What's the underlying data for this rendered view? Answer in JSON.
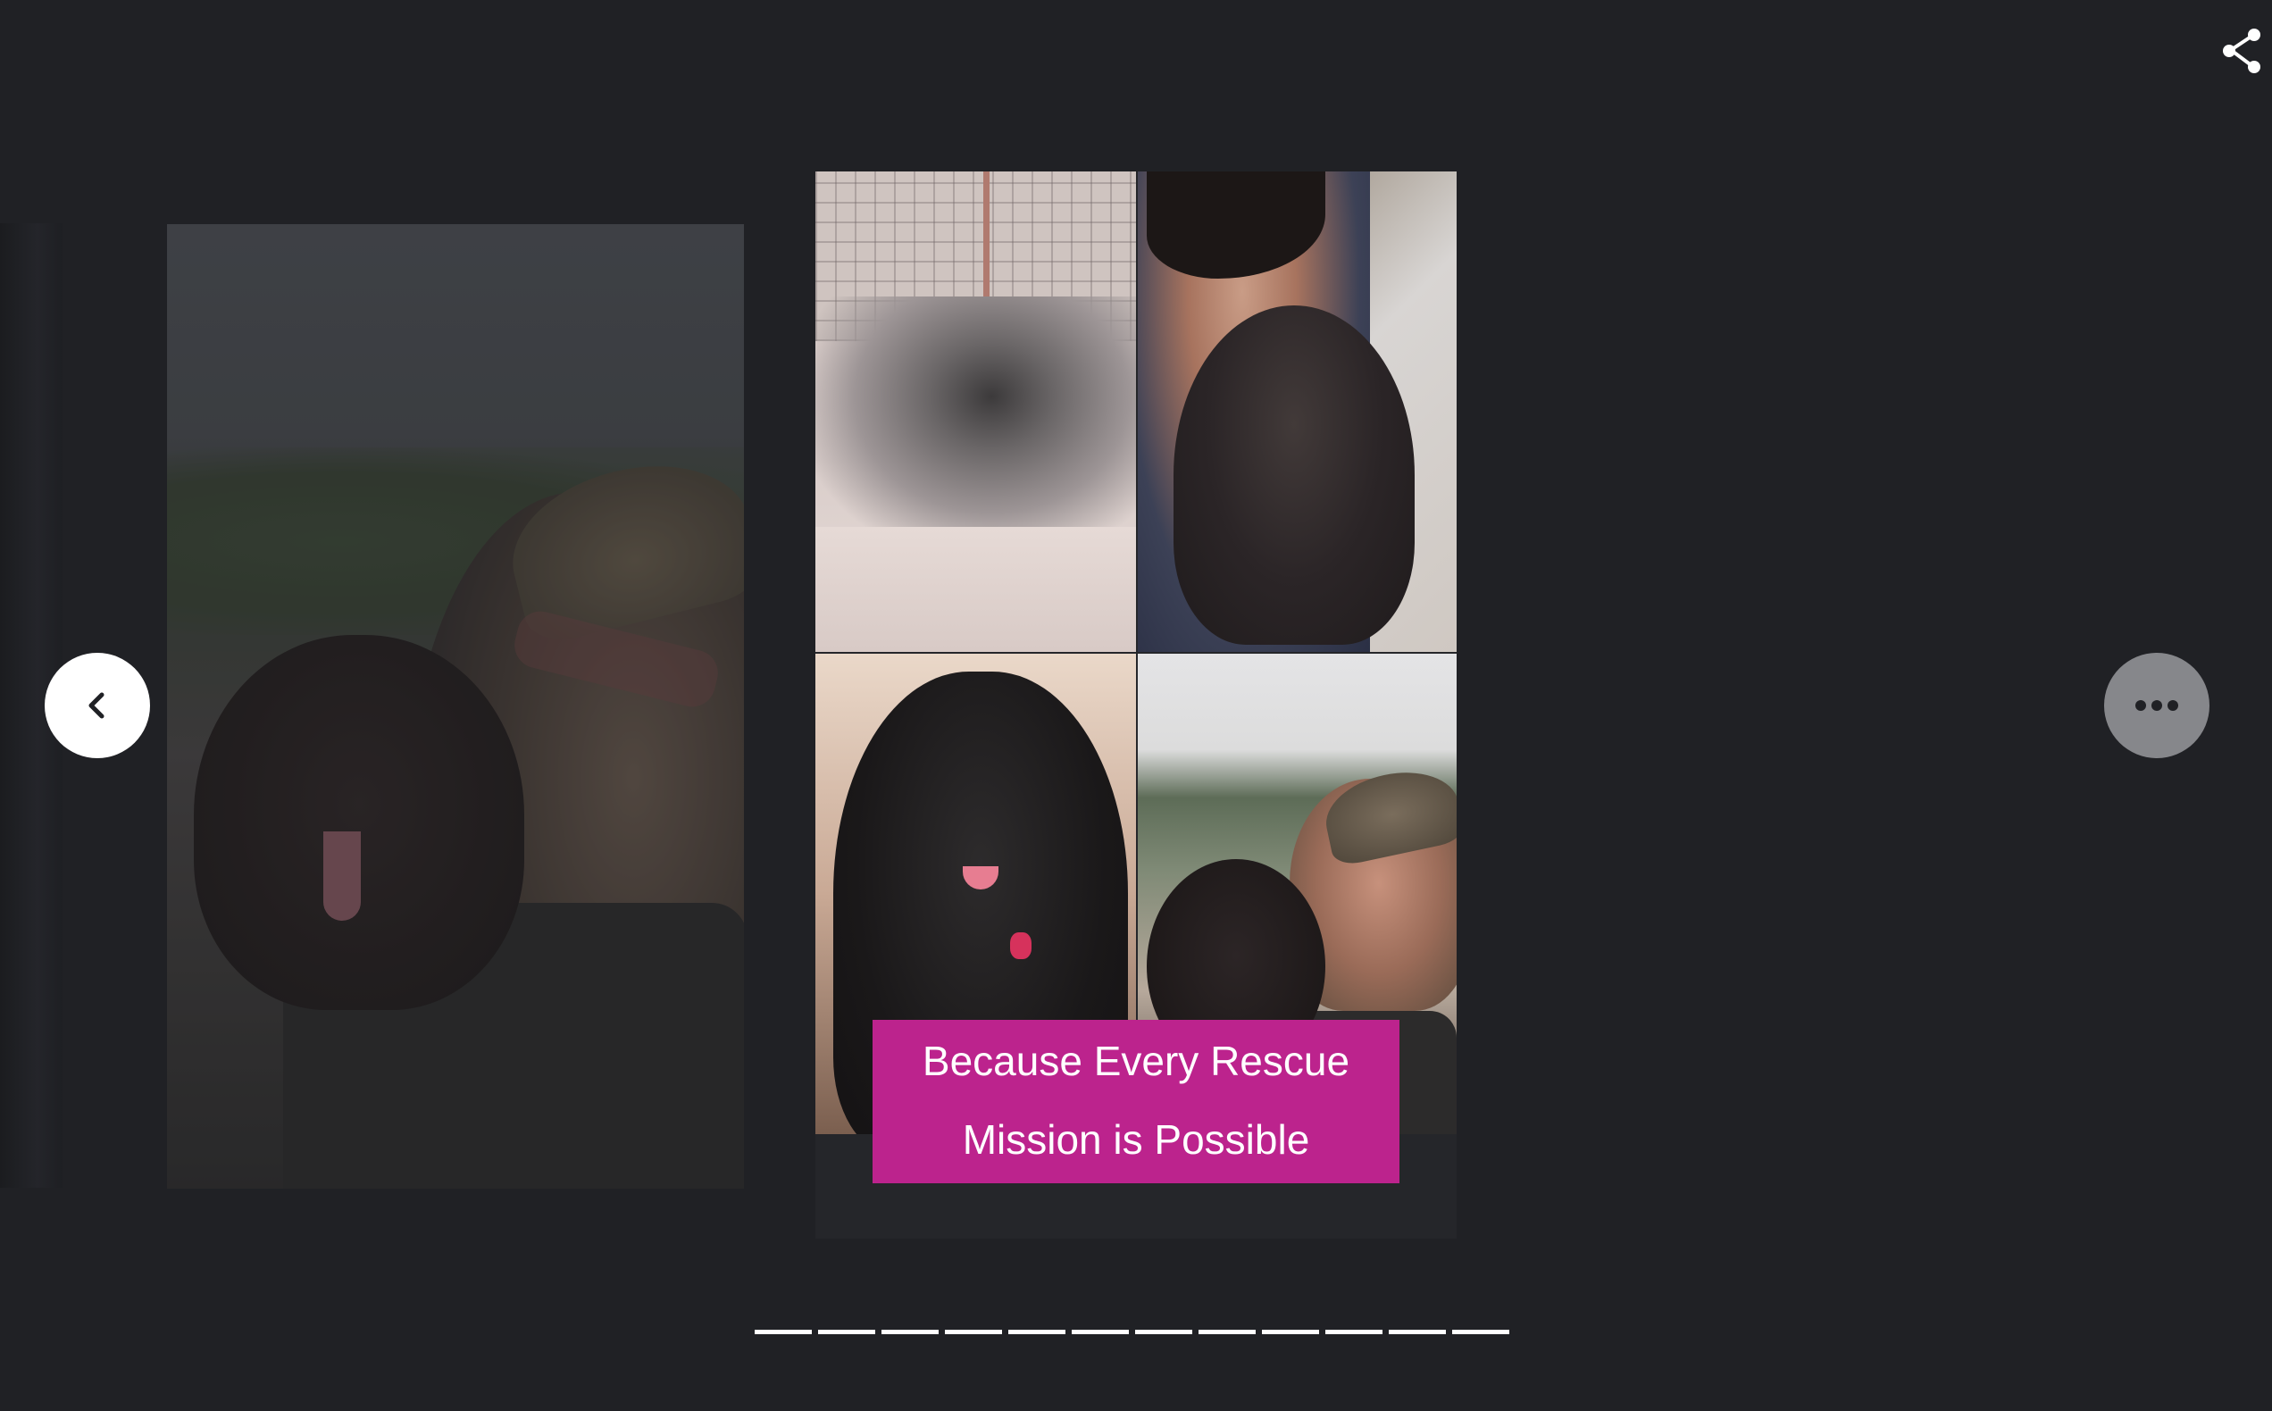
{
  "story": {
    "caption_line1": "Because Every Rescue",
    "caption_line2": "Mission is Possible",
    "caption_color": "#bc238d"
  },
  "controls": {
    "prev_icon": "chevron-left-icon",
    "more_icon": "more-horizontal-icon",
    "share_icon": "share-icon"
  },
  "progress": {
    "total_segments": 12
  },
  "colors": {
    "background": "#202125",
    "progress": "#ffffff"
  }
}
